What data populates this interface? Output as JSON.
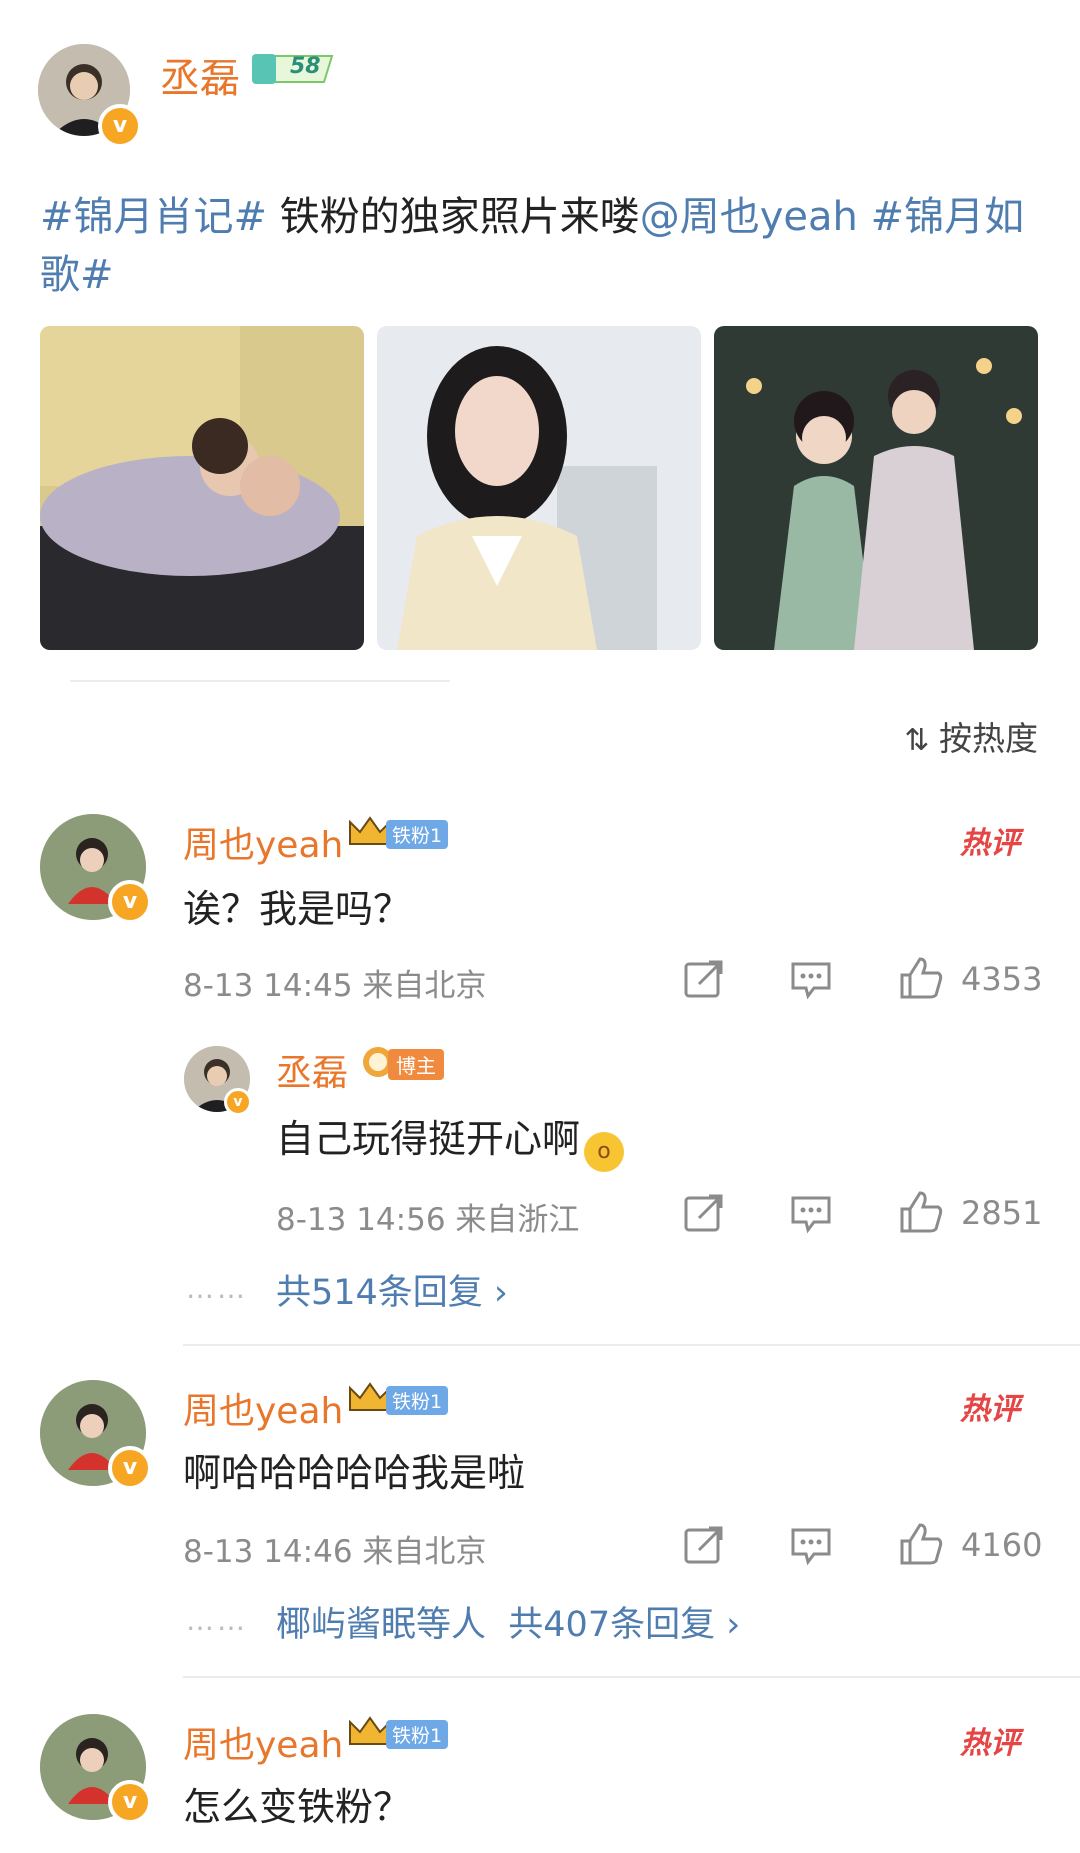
{
  "post": {
    "author": "丞磊",
    "level_badge": "58",
    "text_parts": {
      "tag1": "#锦月肖记#",
      "body": " 铁粉的独家照片来喽",
      "mention": "@周也yeah",
      "tag2": " #锦月如歌#"
    }
  },
  "sort_label": "按热度",
  "comments": [
    {
      "author": "周也yeah",
      "fan_badge": "铁粉1",
      "hot_label": "热评",
      "text": "诶？我是吗？",
      "meta": "8-13 14:45 来自北京",
      "likes": "4353",
      "reply": {
        "author": "丞磊",
        "badge": "博主",
        "text": "自己玩得挺开心啊",
        "meta": "8-13 14:56 来自浙江",
        "likes": "2851"
      },
      "more_replies": "共514条回复 ›"
    },
    {
      "author": "周也yeah",
      "fan_badge": "铁粉1",
      "hot_label": "热评",
      "text": "啊哈哈哈哈哈我是啦",
      "meta": "8-13 14:46 来自北京",
      "likes": "4160",
      "reply_names": "椰屿酱眠等人",
      "more_replies": "共407条回复 ›"
    },
    {
      "author": "周也yeah",
      "fan_badge": "铁粉1",
      "hot_label": "热评",
      "text": "怎么变铁粉？"
    }
  ],
  "dots": "……",
  "icons": [
    "share-icon",
    "comment-icon",
    "like-icon",
    "crown-icon",
    "verified-icon",
    "sort-icon"
  ],
  "colors": {
    "name": "#e8762b",
    "link": "#507daf",
    "hot": "#e54545",
    "meta": "#8b8b8b"
  }
}
